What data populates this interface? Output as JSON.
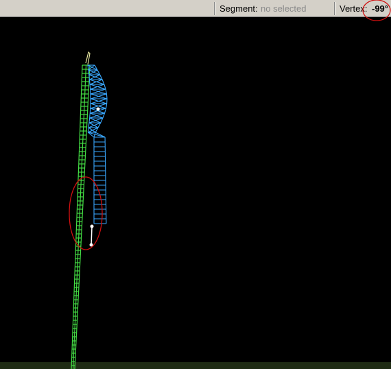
{
  "status_bar": {
    "segment_label": "Segment:",
    "segment_value": "no selected",
    "vertex_label": "Vertex:",
    "vertex_value": "-99°"
  },
  "viewport": {
    "background": "#000000",
    "ground_color": "#1f2c14",
    "green_structure_color": "#44dd44",
    "blue_structure_color": "#3aa8ff",
    "annotation_color": "#d01010"
  }
}
